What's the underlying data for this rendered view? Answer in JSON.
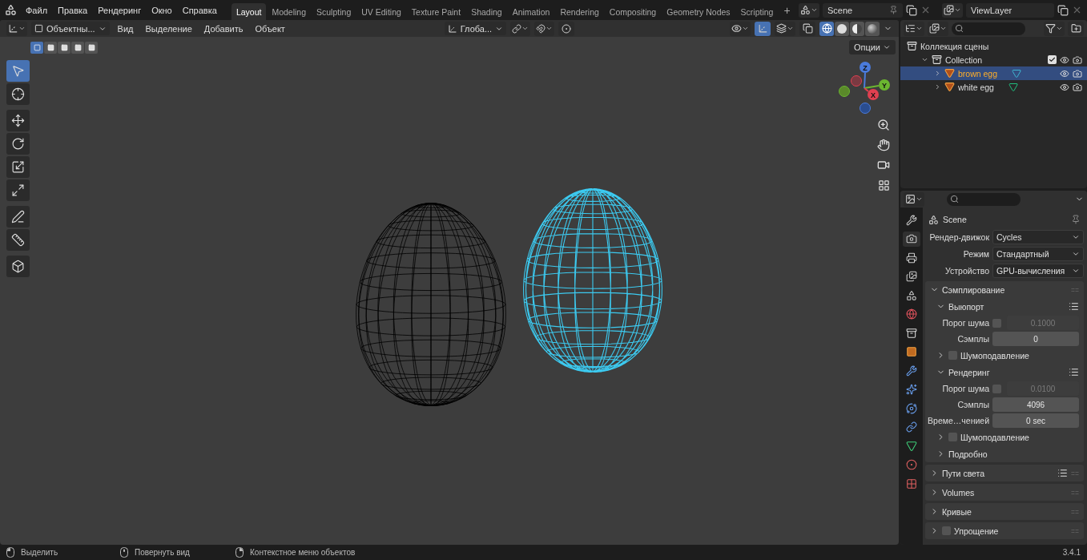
{
  "menu": [
    "Файл",
    "Правка",
    "Рендеринг",
    "Окно",
    "Справка"
  ],
  "workspaces": [
    {
      "label": "Layout",
      "selected": true
    },
    {
      "label": "Modeling",
      "selected": false
    },
    {
      "label": "Sculpting",
      "selected": false
    },
    {
      "label": "UV Editing",
      "selected": false
    },
    {
      "label": "Texture Paint",
      "selected": false
    },
    {
      "label": "Shading",
      "selected": false
    },
    {
      "label": "Animation",
      "selected": false
    },
    {
      "label": "Rendering",
      "selected": false
    },
    {
      "label": "Compositing",
      "selected": false
    },
    {
      "label": "Geometry Nodes",
      "selected": false
    },
    {
      "label": "Scripting",
      "selected": false
    }
  ],
  "add_workspace": "+",
  "scene_selector": {
    "value": "Scene"
  },
  "view_layer_selector": {
    "value": "ViewLayer"
  },
  "viewport": {
    "mode": "Объектны...",
    "menus": [
      "Вид",
      "Выделение",
      "Добавить",
      "Объект"
    ],
    "orientation": "Глоба...",
    "options": "Опции",
    "gizmos_on": true,
    "select_modes": [
      {
        "selected": true
      },
      {
        "selected": false
      },
      {
        "selected": false
      },
      {
        "selected": false
      },
      {
        "selected": false
      }
    ],
    "shading": [
      {
        "kind": "wireframe",
        "selected": true
      },
      {
        "kind": "solid",
        "selected": false
      },
      {
        "kind": "material",
        "selected": false
      },
      {
        "kind": "rendered",
        "selected": false
      }
    ],
    "tools": [
      {
        "kind": "select",
        "selected": true
      },
      {
        "kind": "cursor",
        "selected": false
      },
      {
        "kind": "move",
        "selected": false
      },
      {
        "kind": "rotate",
        "selected": false
      },
      {
        "kind": "scale",
        "selected": false
      },
      {
        "kind": "transform",
        "selected": false
      },
      {
        "kind": "annotate",
        "selected": false
      },
      {
        "kind": "measure",
        "selected": false
      },
      {
        "kind": "add-cube",
        "selected": false
      }
    ],
    "axes": {
      "x": "X",
      "y": "Y",
      "z": "Z"
    }
  },
  "outliner": {
    "root": "Коллекция сцены",
    "items": [
      {
        "kind": "collection",
        "label": "Collection",
        "expanded": true,
        "checked": true,
        "children": [
          {
            "kind": "object",
            "label": "brown egg",
            "selected": true,
            "expanded": false
          },
          {
            "kind": "object",
            "label": "white egg",
            "selected": false,
            "expanded": false
          }
        ]
      }
    ]
  },
  "properties": {
    "tabs": [
      {
        "kind": "tool",
        "selected": false
      },
      {
        "kind": "render",
        "selected": true
      },
      {
        "kind": "output",
        "selected": false
      },
      {
        "kind": "view_layer",
        "selected": false
      },
      {
        "kind": "scene",
        "selected": false
      },
      {
        "kind": "world",
        "selected": false
      },
      {
        "kind": "collection",
        "selected": false
      },
      {
        "kind": "object",
        "selected": false
      },
      {
        "kind": "modifiers",
        "selected": false
      },
      {
        "kind": "particles",
        "selected": false
      },
      {
        "kind": "physics",
        "selected": false
      },
      {
        "kind": "constraints",
        "selected": false
      },
      {
        "kind": "data",
        "selected": false
      },
      {
        "kind": "material",
        "selected": false
      },
      {
        "kind": "texture",
        "selected": false
      }
    ],
    "context": "Scene",
    "fields": [
      {
        "label": "Рендер-движок",
        "value": "Cycles"
      },
      {
        "label": "Режим",
        "value": "Стандартный"
      },
      {
        "label": "Устройство",
        "value": "GPU-вычисления"
      }
    ],
    "panels": [
      {
        "label": "Сэмплирование",
        "expanded": true,
        "children": [
          {
            "kind": "subpanel",
            "label": "Выюпорт",
            "expanded": true,
            "presets": true,
            "children": [
              {
                "kind": "toggle_number",
                "label": "Порог шума",
                "checked": false,
                "value": "0.1000"
              },
              {
                "kind": "number",
                "label": "Сэмплы",
                "value": "0"
              },
              {
                "kind": "subpanel",
                "label": "Шумоподавление",
                "expanded": false,
                "checked": false
              }
            ]
          },
          {
            "kind": "subpanel",
            "label": "Рендеринг",
            "expanded": true,
            "presets": true,
            "children": [
              {
                "kind": "toggle_number",
                "label": "Порог шума",
                "checked": false,
                "value": "0.0100"
              },
              {
                "kind": "number",
                "label": "Сэмплы",
                "value": "4096"
              },
              {
                "kind": "number",
                "label": "Време…ченией",
                "value": "0 sec"
              },
              {
                "kind": "subpanel",
                "label": "Шумоподавление",
                "expanded": false,
                "checked": false
              }
            ]
          },
          {
            "kind": "subpanel",
            "label": "Подробно",
            "expanded": false
          }
        ]
      },
      {
        "label": "Пути света",
        "expanded": false,
        "presets": true
      },
      {
        "label": "Volumes",
        "expanded": false
      },
      {
        "label": "Кривые",
        "expanded": false
      },
      {
        "label": "Упрощение",
        "expanded": false,
        "checked": false
      }
    ]
  },
  "status_bar": {
    "hints": [
      {
        "kind": "left",
        "label": "Выделить"
      },
      {
        "kind": "middle",
        "label": "Повернуть вид"
      },
      {
        "kind": "right",
        "label": "Контекстное меню объектов"
      }
    ],
    "version": "3.4.1"
  }
}
